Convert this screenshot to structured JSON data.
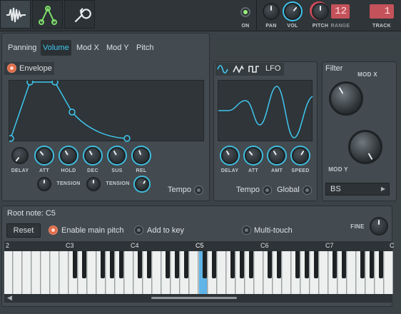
{
  "top": {
    "tabs": [
      {
        "icon": "waveform-icon"
      },
      {
        "icon": "envelope-node-icon"
      },
      {
        "icon": "wrench-icon"
      }
    ],
    "on_label": "ON",
    "pan_label": "PAN",
    "vol_label": "VOL",
    "pitch_label": "PITCH",
    "range_label": "RANGE",
    "range_value": "12",
    "track_label": "TRACK",
    "track_value": "1"
  },
  "params_tabs": [
    "Panning",
    "Volume",
    "Mod X",
    "Mod Y",
    "Pitch"
  ],
  "active_param_tab": "Volume",
  "envelope": {
    "label": "Envelope",
    "knobs": [
      "DELAY",
      "ATT",
      "HOLD",
      "DEC",
      "SUS",
      "REL"
    ],
    "tension_label_1": "TENSION",
    "tension_label_2": "TENSION",
    "tempo_label": "Tempo"
  },
  "lfo": {
    "label": "LFO",
    "knobs": [
      "DELAY",
      "ATT",
      "AMT",
      "SPEED"
    ],
    "tempo_label": "Tempo",
    "global_label": "Global"
  },
  "filter": {
    "title": "Filter",
    "modx_label": "MOD X",
    "mody_label": "MOD Y",
    "type_value": "BS"
  },
  "keyboard": {
    "root_note": "Root note: C5",
    "reset_label": "Reset",
    "enable_main_pitch": "Enable main pitch",
    "add_to_key": "Add to key",
    "multi_touch": "Multi-touch",
    "fine_label": "FINE",
    "octave_labels": [
      "2",
      "C3",
      "C4",
      "C5",
      "C6",
      "C7",
      "C"
    ]
  },
  "colors": {
    "accent": "#3fc7f0",
    "active_radio": "#e06a4a",
    "range_badge": "#c4525a",
    "track_badge": "#c4525a",
    "on_led": "#7fe06a"
  }
}
